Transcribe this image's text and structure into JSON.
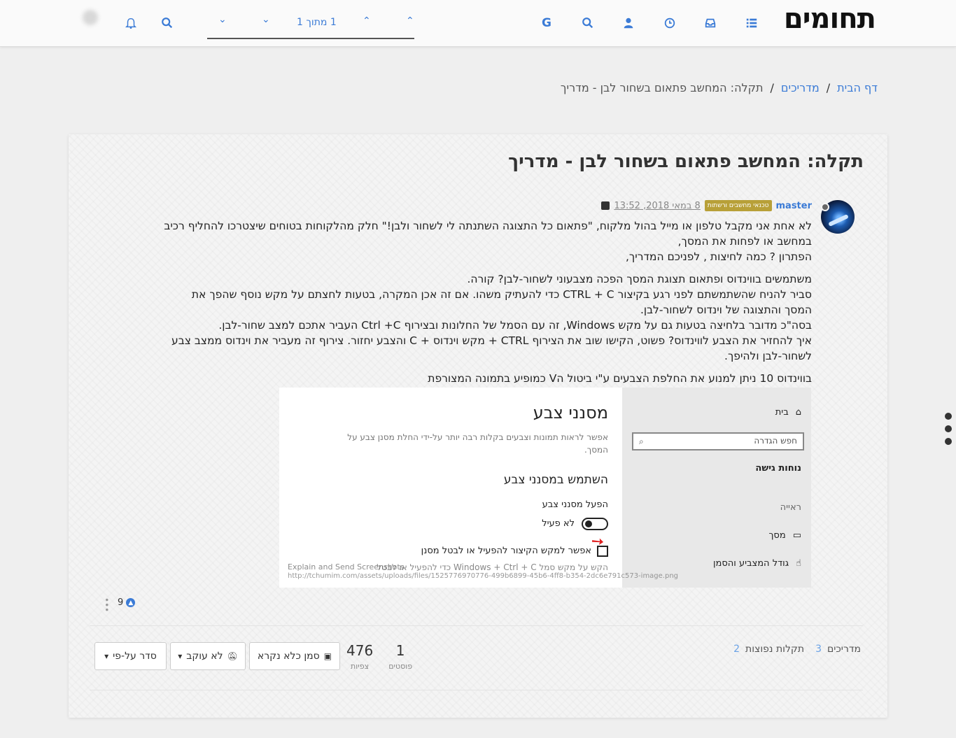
{
  "brand": {
    "title": "תחומים"
  },
  "topbar": {
    "icons": [
      "list-icon",
      "inbox-icon",
      "clock-icon",
      "user-icon",
      "search-icon",
      "google-icon"
    ],
    "pager": {
      "text": "1 מתוך 1"
    },
    "right_icons": [
      "search-icon",
      "bell-icon"
    ]
  },
  "breadcrumb": {
    "home": "דף הבית",
    "category": "מדריכים",
    "current": "תקלה: המחשב פתאום בשחור לבן - מדריך"
  },
  "topic": {
    "title": "תקלה: המחשב פתאום בשחור לבן - מדריך"
  },
  "post": {
    "author": "master",
    "badge": "טכנאי מחשבים ורשתות",
    "timestamp": "8 במאי 2018, 13:52",
    "paragraphs": [
      "לא אחת אני מקבל טלפון או מייל בהול מלקוח, \"פתאום כל התצוגה השתנתה לי לשחור ולבן!\" חלק מהלקוחות בטוחים שיצטרכו להחליף רכיב במחשב או לפחות את המסך,",
      "הפתרון ? כמה לחיצות , לפניכם המדריך,",
      "משתמשים בווינדוס ופתאום תצוגת המסך הפכה מצבעוני לשחור-לבן? קורה.",
      "סביר להניח שהשתמשתם לפני רגע בקיצור CTRL + C כדי להעתיק משהו. אם זה אכן המקרה, בטעות לחצתם על מקש נוסף שהפך את המסך והתצוגה של וינדוס לשחור-לבן.",
      "בסה\"כ מדובר בלחיצה בטעות גם על מקש Windows, זה עם הסמל של החלונות ובצירוף Ctrl +C העביר אתכם למצב שחור-לבן.",
      "איך להחזיר את הצבע לווינדוס? פשוט, הקישו שוב את הצירוף CTRL + מקש וינדוס + C והצבע יחזור. צירוף זה מעביר את וינדוס ממצב צבע לשחור-לבן ולהיפך.",
      "בווינדוס 10 ניתן למנוע את החלפת הצבעים ע\"י ביטול הV כמופיע בתמונה המצורפת"
    ],
    "votes": "9"
  },
  "screenshot": {
    "side_home": "בית",
    "side_search_placeholder": "חפש הגדרה",
    "side_section": "נוחות גישה",
    "side_vision": "ראייה",
    "side_display": "מסך",
    "side_cursor": "גודל המצביע והסמן",
    "title": "מסנני צבע",
    "desc": "אפשר לראות תמונות וצבעים בקלות רבה יותר על-ידי החלת מסנן צבע על המסך.",
    "subtitle": "השתמש במסנני צבע",
    "enable_label": "הפעל מסנני צבע",
    "toggle_label": "לא פעיל",
    "checkbox_label": "אפשר למקש הקיצור להפעיל או לבטל מסנן",
    "hint": "הקש על מקש סמל Windows + Ctrl + C כדי להפעיל או לבטל",
    "watermark1": "Explain and Send Screenshots",
    "watermark2": "http://tchumim.com/assets/uploads/files/1525776970776-499b6899-45b6-4ff8-b354-2dc6e791c573-image.png"
  },
  "footer": {
    "tag1": {
      "label": "מדריכים",
      "count": "3"
    },
    "tag2": {
      "label": "תקלות נפוצות",
      "count": "2"
    },
    "posts": {
      "num": "1",
      "label": "פוסטים"
    },
    "views": {
      "num": "476",
      "label": "צפיות"
    },
    "mark_unread": "סמן כלא נקרא",
    "not_following": "לא עוקב",
    "sort_by": "סדר על-פי"
  }
}
